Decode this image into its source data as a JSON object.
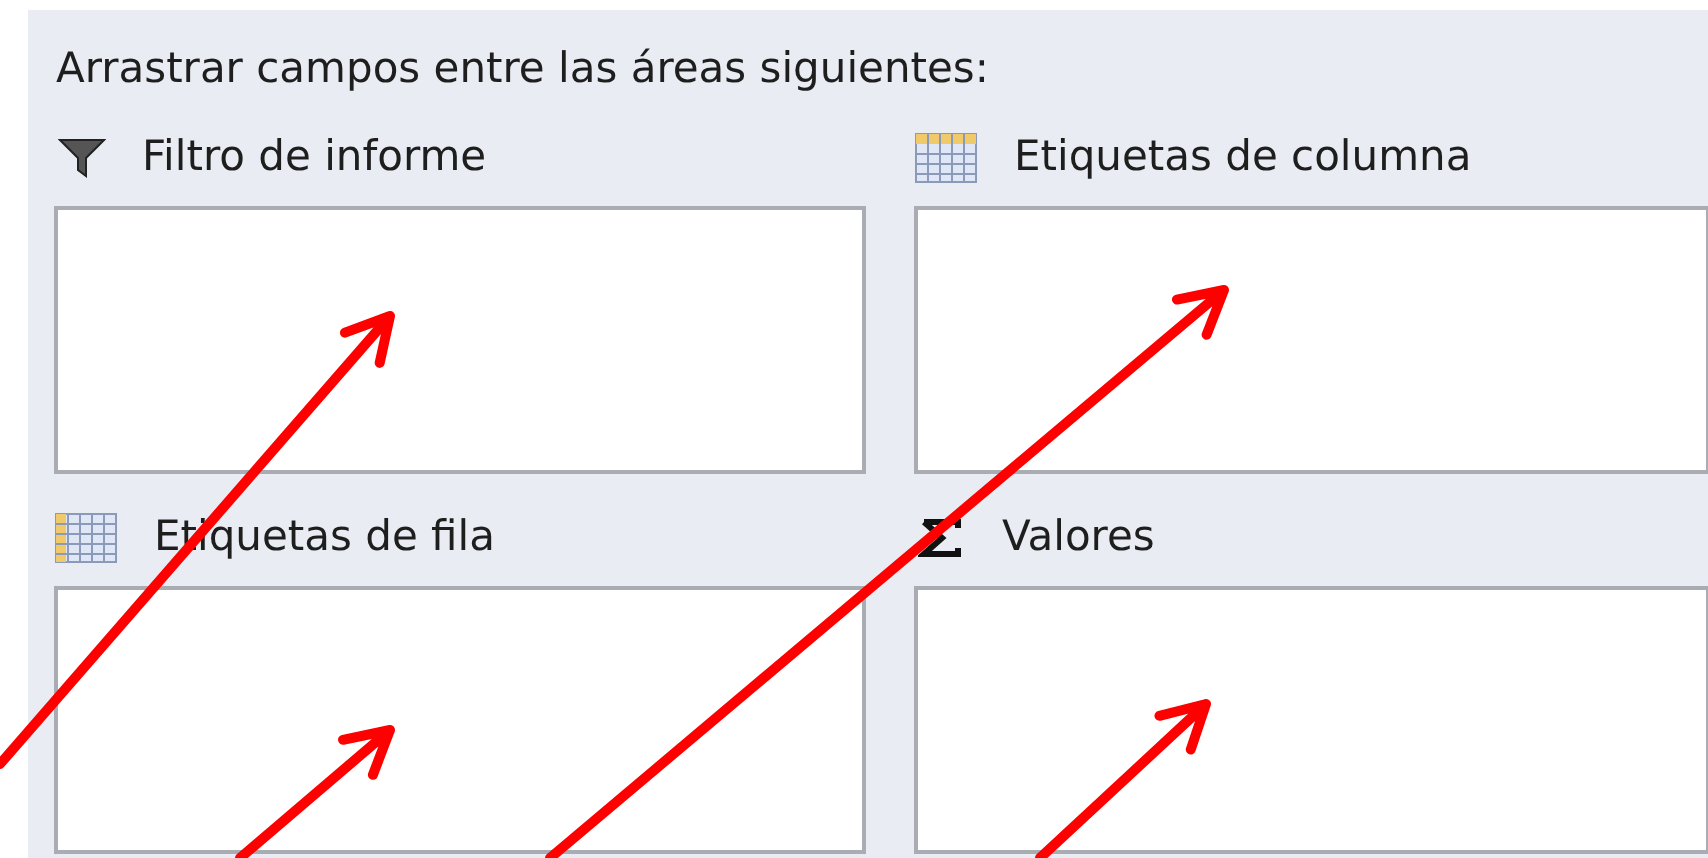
{
  "instruction": "Arrastrar campos entre las áreas siguientes:",
  "areas": [
    {
      "label": "Filtro de informe",
      "kind": "filter"
    },
    {
      "label": "Etiquetas de columna",
      "kind": "columns"
    },
    {
      "label": "Etiquetas de fila",
      "kind": "rows"
    },
    {
      "label": "Valores",
      "kind": "values"
    }
  ],
  "annotations": [
    {
      "kind": "arrow"
    },
    {
      "kind": "arrow"
    },
    {
      "kind": "arrow"
    },
    {
      "kind": "arrow"
    }
  ]
}
